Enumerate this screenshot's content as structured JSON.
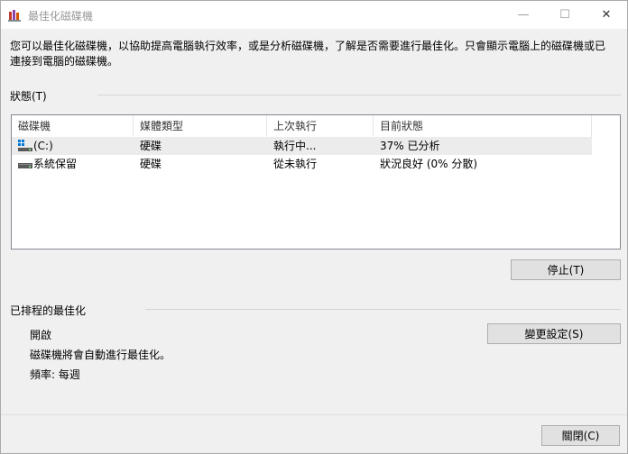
{
  "window": {
    "title": "最佳化磁碟機",
    "minimize_glyph": "—",
    "maximize_glyph": "☐",
    "close_glyph": "✕"
  },
  "description": "您可以最佳化磁碟機，以協助提高電腦執行效率，或是分析磁碟機，了解是否需要進行最佳化。只會顯示電腦上的磁碟機或已連接到電腦的磁碟機。",
  "status": {
    "heading": "狀態(T)",
    "columns": [
      "磁碟機",
      "媒體類型",
      "上次執行",
      "目前狀態"
    ],
    "rows": [
      {
        "drive": "(C:)",
        "media": "硬碟",
        "last_run": "執行中...",
        "status": "37% 已分析",
        "icon": "windows-drive-icon"
      },
      {
        "drive": "系統保留",
        "media": "硬碟",
        "last_run": "從未執行",
        "status": "狀況良好 (0% 分散)",
        "icon": "hard-drive-icon"
      }
    ],
    "stop_button": "停止(T)"
  },
  "scheduled": {
    "heading": "已排程的最佳化",
    "state": "開啟",
    "note": "磁碟機將會自動進行最佳化。",
    "frequency": "頻率: 每週",
    "change_button": "變更設定(S)"
  },
  "footer": {
    "close_button": "關閉(C)"
  }
}
